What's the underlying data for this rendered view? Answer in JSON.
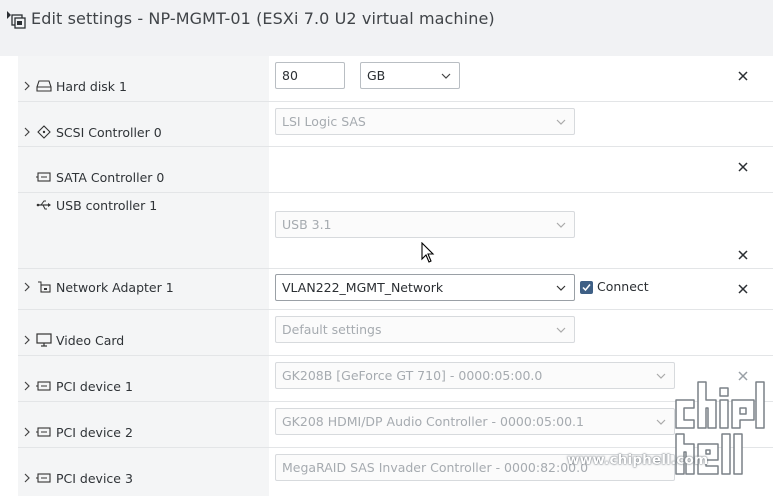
{
  "dialog": {
    "title": "Edit settings - NP-MGMT-01 (ESXi 7.0 U2 virtual machine)"
  },
  "devices": {
    "hard_disk": {
      "label": "Hard disk 1",
      "size_value": "80",
      "size_unit": "GB"
    },
    "scsi": {
      "label": "SCSI Controller 0",
      "type": "LSI Logic SAS"
    },
    "sata": {
      "label": "SATA Controller 0"
    },
    "usb": {
      "label": "USB controller 1",
      "type": "USB 3.1"
    },
    "network": {
      "label": "Network Adapter 1",
      "network": "VLAN222_MGMT_Network",
      "connect_label": "Connect",
      "connected": true
    },
    "video": {
      "label": "Video Card",
      "setting": "Default settings"
    },
    "pci1": {
      "label": "PCI device 1",
      "device": "GK208B [GeForce GT 710] - 0000:05:00.0"
    },
    "pci2": {
      "label": "PCI device 2",
      "device": "GK208 HDMI/DP Audio Controller - 0000:05:00.1"
    },
    "pci3": {
      "label": "PCI device 3",
      "device": "MegaRAID SAS Invader Controller - 0000:82:00.0"
    }
  },
  "watermark": {
    "url": "www.chiphell.com"
  },
  "colors": {
    "checkbox": "#3e5f85",
    "label_column": "#f4f5f6",
    "header": "#f1f2f4"
  }
}
